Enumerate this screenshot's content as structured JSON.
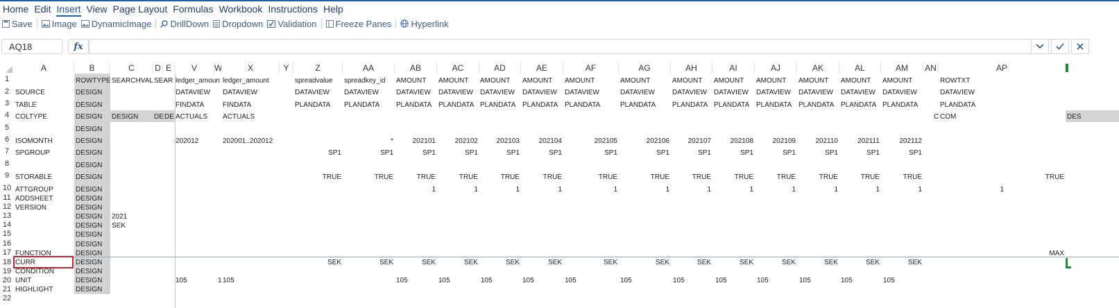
{
  "menu": [
    "Home",
    "Edit",
    "Insert",
    "View",
    "Page Layout",
    "Formulas",
    "Workbook",
    "Instructions",
    "Help"
  ],
  "active_menu": "Insert",
  "toolbar": [
    {
      "label": "Save",
      "icon": "save-icon"
    },
    {
      "label": "Image",
      "icon": "image-icon"
    },
    {
      "label": "DynamicImage",
      "icon": "dynamic-image-icon"
    },
    {
      "label": "DrillDown",
      "icon": "search-icon"
    },
    {
      "label": "Dropdown",
      "icon": "dropdown-icon"
    },
    {
      "label": "Validation",
      "icon": "validation-icon"
    },
    {
      "label": "Freeze Panes",
      "icon": "freeze-panes-icon"
    },
    {
      "label": "Hyperlink",
      "icon": "globe-icon"
    }
  ],
  "formula_bar": {
    "cell_ref": "AQ18",
    "fx": "fx",
    "value": ""
  },
  "columns": [
    "A",
    "B",
    "C",
    "D",
    "E",
    "V",
    "W",
    "X",
    "Y",
    "Z",
    "AA",
    "AB",
    "AC",
    "AD",
    "AE",
    "AF",
    "AG",
    "AH",
    "AI",
    "AJ",
    "AK",
    "AL",
    "AM",
    "AN",
    "AP"
  ],
  "rows": [
    "1",
    "2",
    "3",
    "4",
    "5",
    "6",
    "7",
    "8",
    "9",
    "10",
    "11",
    "12",
    "13",
    "14",
    "15",
    "16",
    "17",
    "18",
    "19",
    "20",
    "21",
    "22"
  ],
  "labels_a": {
    "r2": "SOURCE",
    "r3": "TABLE",
    "r4": "COLTYPE",
    "r6": "ISOMONTH",
    "r7": "SPGROUP",
    "r9": "STORABLE",
    "r10": "ATTGROUP",
    "r11": "ADDSHEET",
    "r12": "VERSION",
    "r17": "FUNCTION",
    "r18": "CURR",
    "r19": "CONDITION",
    "r20": "UNIT",
    "r21": "HIGHLIGHT"
  },
  "design": "DESIGN",
  "row1": {
    "b": "ROWTYPE",
    "c": "SEARCHVAL",
    "d": "SEAR",
    "v": "ledger_amoun",
    "x": "ledger_amount",
    "z": "spreadvalue",
    "aa": "spreadkey_id",
    "ap": "ROWTXT"
  },
  "amount": "AMOUNT",
  "dataview": "DATAVIEW",
  "findata": "FINDATA",
  "plandata": "PLANDATA",
  "row4": {
    "c": "DESIGN",
    "d": "DE",
    "e": "DE",
    "v": "ACTUALS",
    "x": "ACTUALS",
    "an": "C",
    "ap": "COM",
    "far": "DES"
  },
  "row6": {
    "v": "202012",
    "x": "202001..202012",
    "aa": "*"
  },
  "months": [
    "202101",
    "202102",
    "202103",
    "202104",
    "202105",
    "202106",
    "202107",
    "202108",
    "202109",
    "202110",
    "202111",
    "202112"
  ],
  "sp1": "SP1",
  "true": "TRUE",
  "one": "1",
  "c13": "2021",
  "c14": "SEK",
  "sek": "SEK",
  "max": "MAX",
  "unit105": "105",
  "w20": "1"
}
